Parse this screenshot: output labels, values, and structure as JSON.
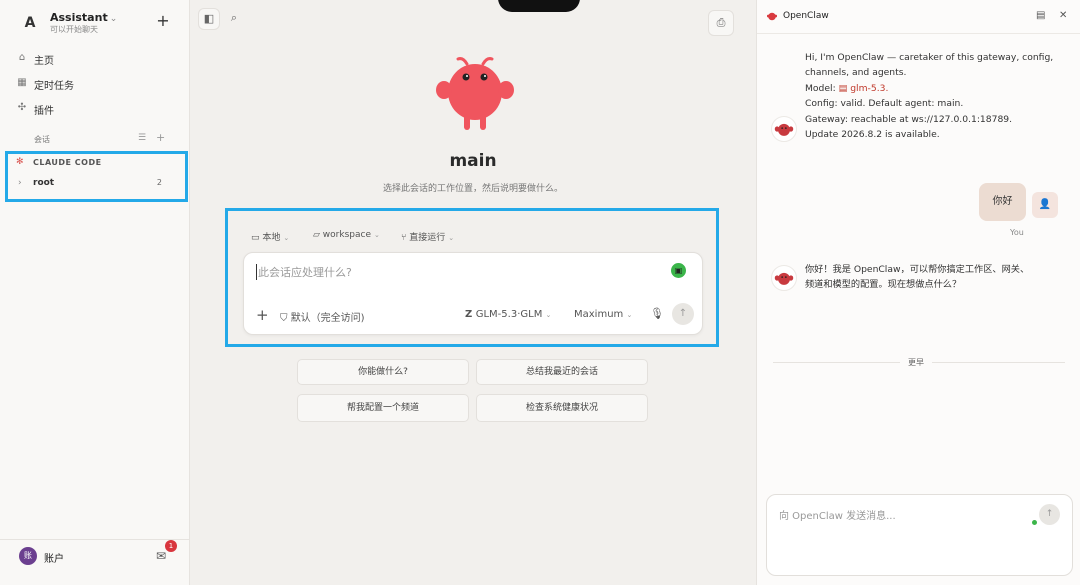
{
  "sidebar": {
    "account": {
      "avatar_letter": "A",
      "name": "Assistant",
      "subtitle": "可以开始聊天"
    },
    "nav": [
      {
        "label": "主页",
        "icon": "home-icon"
      },
      {
        "label": "定时任务",
        "icon": "calendar-icon"
      },
      {
        "label": "插件",
        "icon": "puzzle-icon"
      }
    ],
    "sessions_header": "会话",
    "project": {
      "label": "CLAUDE CODE"
    },
    "root": {
      "label": "root",
      "count": "2"
    },
    "user": {
      "avatar": "账",
      "label": "账户",
      "badge": "1"
    }
  },
  "main": {
    "title": "main",
    "subtitle": "选择此会话的工作位置，然后说明要做什么。",
    "options": {
      "location": "本地",
      "folder": "workspace",
      "mode": "直接运行"
    },
    "composer": {
      "placeholder": "此会话应处理什么?",
      "permission": "默认（完全访问)",
      "model": "GLM-5.3·GLM",
      "effort": "Maximum"
    },
    "suggestions": [
      "你能做什么?",
      "总结我最近的会话",
      "帮我配置一个频道",
      "检查系统健康状况"
    ]
  },
  "chat": {
    "title": "OpenClaw",
    "bot_greeting": {
      "line1": "Hi, I'm OpenClaw — caretaker of this gateway, config,",
      "line2": "channels, and agents.",
      "model_prefix": "Model: ",
      "model_link": "glm-5.3",
      "model_suffix": ".",
      "line4": "Config: valid. Default agent: main.",
      "line5": "Gateway: reachable at ws://127.0.0.1:18789.",
      "line6": "Update 2026.8.2 is available."
    },
    "user_message": "你好",
    "user_label": "You",
    "bot_reply": {
      "line1": "你好！我是 OpenClaw，可以帮你搞定工作区、网关、",
      "line2": "频道和模型的配置。现在想做点什么？"
    },
    "divider_label": "更早",
    "input_placeholder": "向 OpenClaw 发送消息..."
  },
  "colors": {
    "highlight": "#24a9e8",
    "mascot": "#f0555e",
    "accent_red": "#c0392b",
    "status_green": "#3bb54a"
  }
}
